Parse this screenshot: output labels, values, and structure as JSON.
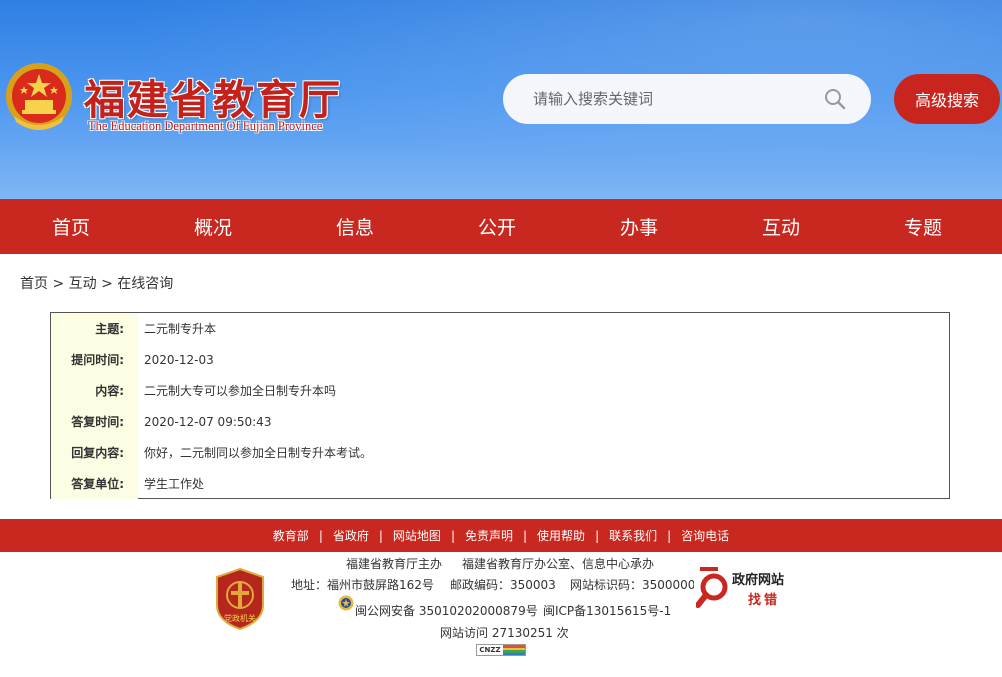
{
  "header": {
    "title": "福建省教育厅",
    "subtitle": "The Education Department Of Fujian Province",
    "search_placeholder": "请输入搜索关键词",
    "advanced_search": "高级搜索"
  },
  "nav": {
    "items": [
      {
        "label": "首页"
      },
      {
        "label": "概况"
      },
      {
        "label": "信息"
      },
      {
        "label": "公开"
      },
      {
        "label": "办事"
      },
      {
        "label": "互动"
      },
      {
        "label": "专题"
      }
    ]
  },
  "breadcrumb": {
    "text": "首页 > 互动 > 在线咨询"
  },
  "qa": {
    "rows": [
      {
        "label": "主题:",
        "value": "二元制专升本"
      },
      {
        "label": "提问时间:",
        "value": "2020-12-03"
      },
      {
        "label": "内容:",
        "value": "二元制大专可以参加全日制专升本吗"
      },
      {
        "label": "答复时间:",
        "value": "2020-12-07 09:50:43"
      },
      {
        "label": "回复内容:",
        "value": "你好，二元制同以参加全日制专升本考试。"
      },
      {
        "label": "答复单位:",
        "value": "学生工作处"
      }
    ]
  },
  "footer": {
    "links": [
      {
        "label": "教育部"
      },
      {
        "label": "省政府"
      },
      {
        "label": "网站地图"
      },
      {
        "label": "免责声明"
      },
      {
        "label": "使用帮助"
      },
      {
        "label": "联系我们"
      },
      {
        "label": "咨询电话"
      }
    ],
    "separator": "|",
    "sponsor": "福建省教育厅主办",
    "organizer": "福建省教育厅办公室、信息中心承办",
    "address": "地址：福州市鼓屏路162号",
    "postcode": "邮政编码：350003",
    "site_id": "网站标识码：3500000",
    "police_record": "闽公网安备 35010202000879号",
    "icp_record": "闽ICP备13015615号-1",
    "visits": "网站访问 27130251 次",
    "badge_text": "党政机关",
    "gov_error_line1": "政府网站",
    "gov_error_line2": "找错",
    "cnzz": "CNZZ"
  },
  "colors": {
    "brand_red": "#c8281f",
    "header_blue": "#3d8be9",
    "label_bg": "#fdfde3"
  },
  "icons": {
    "emblem": "national-emblem-icon",
    "search": "search-icon",
    "badge": "party-government-badge-icon",
    "police": "police-badge-icon",
    "gov_error": "magnifier-icon"
  }
}
